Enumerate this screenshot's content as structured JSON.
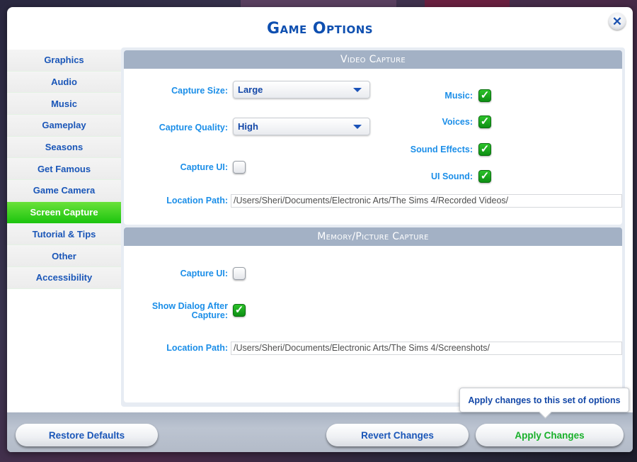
{
  "dialog": {
    "title": "Game Options",
    "close_icon": "close-icon"
  },
  "sidebar": {
    "active_index": 7,
    "items": [
      {
        "label": "Graphics"
      },
      {
        "label": "Audio"
      },
      {
        "label": "Music"
      },
      {
        "label": "Gameplay"
      },
      {
        "label": "Seasons"
      },
      {
        "label": "Get Famous"
      },
      {
        "label": "Game Camera"
      },
      {
        "label": "Screen Capture"
      },
      {
        "label": "Tutorial & Tips"
      },
      {
        "label": "Other"
      },
      {
        "label": "Accessibility"
      }
    ]
  },
  "video_capture": {
    "header": "Video Capture",
    "capture_size": {
      "label": "Capture Size:",
      "value": "Large"
    },
    "capture_quality": {
      "label": "Capture Quality:",
      "value": "High"
    },
    "capture_ui": {
      "label": "Capture UI:",
      "checked": false
    },
    "music": {
      "label": "Music:",
      "checked": true
    },
    "voices": {
      "label": "Voices:",
      "checked": true
    },
    "sound_effects": {
      "label": "Sound Effects:",
      "checked": true
    },
    "ui_sound": {
      "label": "UI Sound:",
      "checked": true
    },
    "location_path": {
      "label": "Location Path:",
      "value": "/Users/Sheri/Documents/Electronic Arts/The Sims 4/Recorded Videos/"
    }
  },
  "memory_capture": {
    "header": "Memory/Picture Capture",
    "capture_ui": {
      "label": "Capture UI:",
      "checked": false
    },
    "show_dialog": {
      "label_line1": "Show Dialog After",
      "label_line2": "Capture:",
      "checked": true
    },
    "location_path": {
      "label": "Location Path:",
      "value": "/Users/Sheri/Documents/Electronic Arts/The Sims 4/Screenshots/"
    }
  },
  "footer": {
    "restore_defaults": "Restore Defaults",
    "revert_changes": "Revert Changes",
    "apply_changes": "Apply Changes",
    "apply_tooltip": "Apply changes to this set of options"
  },
  "glyphs": {
    "check": "✓",
    "close": "✕"
  }
}
